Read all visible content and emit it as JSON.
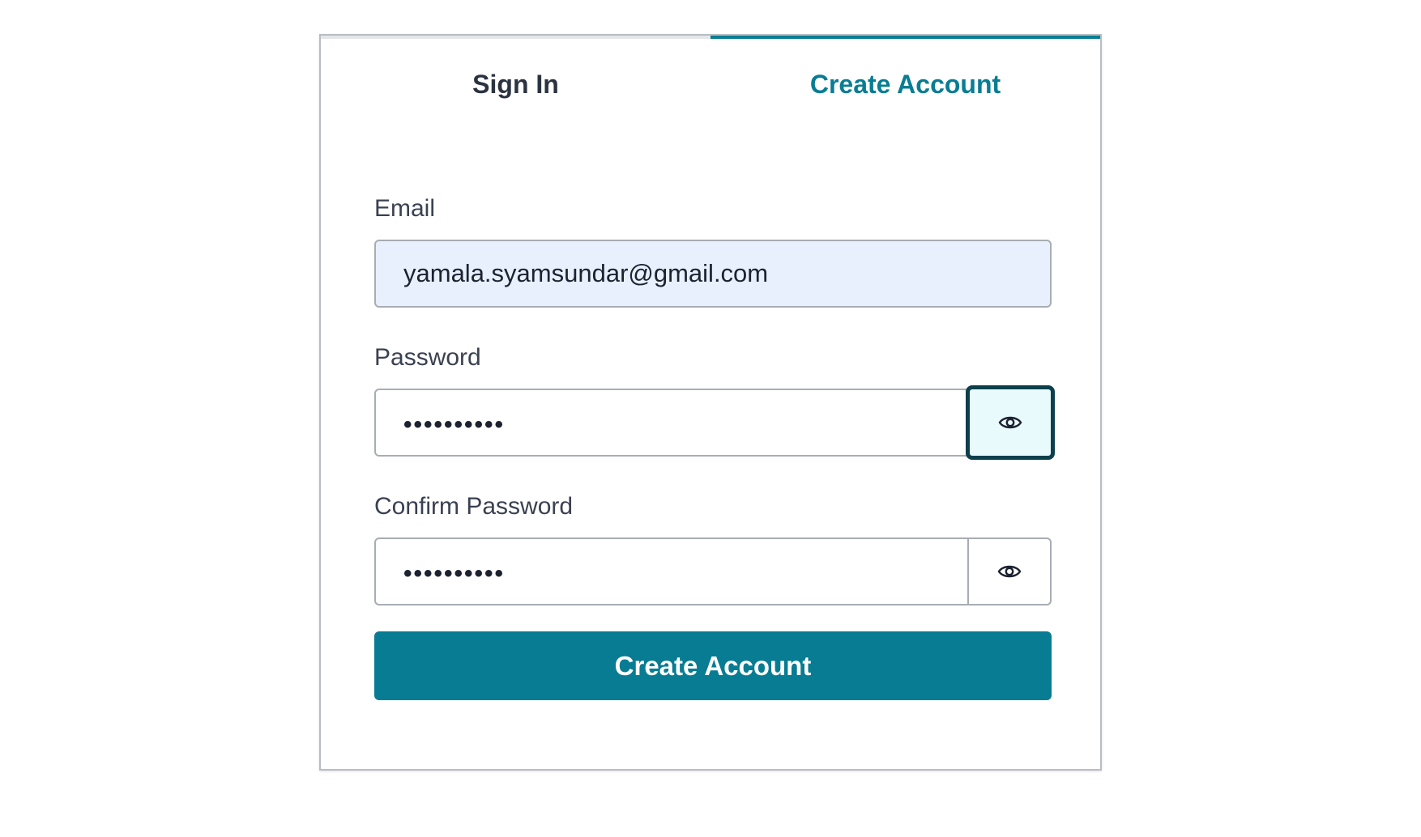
{
  "tabs": {
    "sign_in": "Sign In",
    "create_account": "Create Account",
    "active": "create_account"
  },
  "form": {
    "email": {
      "label": "Email",
      "value": "yamala.syamsundar@gmail.com"
    },
    "password": {
      "label": "Password",
      "masked_value": "••••••••••",
      "toggle_icon": "eye-icon"
    },
    "confirm_password": {
      "label": "Confirm Password",
      "masked_value": "••••••••••",
      "toggle_icon": "eye-icon"
    },
    "submit_label": "Create Account"
  },
  "colors": {
    "accent": "#087d93",
    "focus_ring": "#0c3f4c",
    "autofill_bg": "#e8f0fd",
    "text": "#2b3340"
  }
}
